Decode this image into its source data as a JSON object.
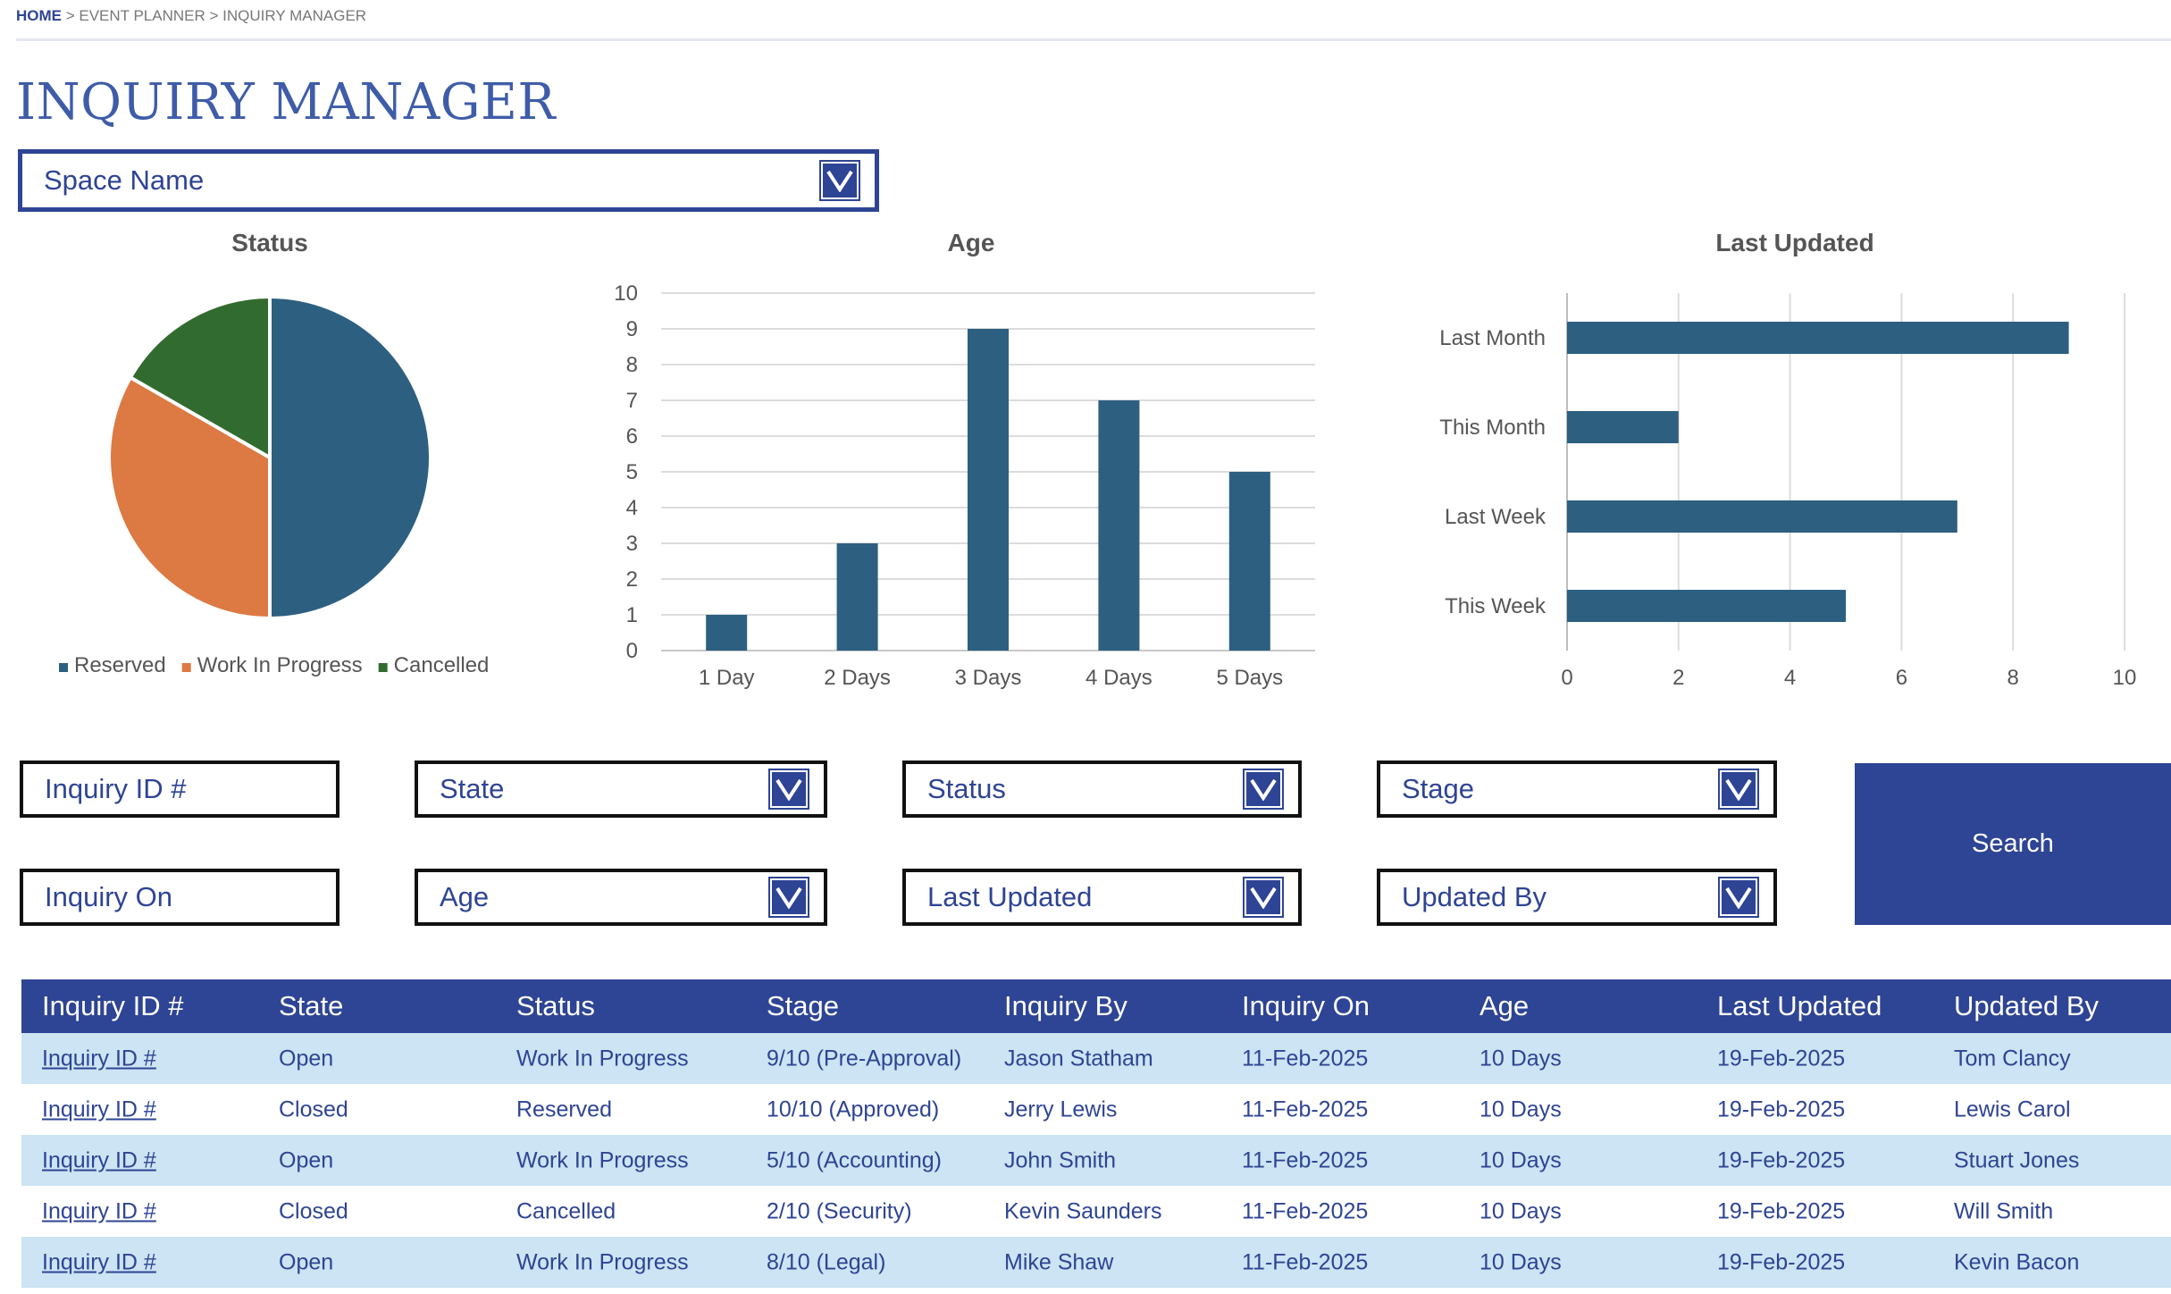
{
  "breadcrumb": {
    "home": "HOME",
    "separator": " > ",
    "event_planner": "EVENT PLANNER",
    "current": "INQUIRY MANAGER"
  },
  "page_title": "INQUIRY MANAGER",
  "space_name": {
    "label": "Space Name",
    "icon": "chevron-down-icon"
  },
  "filters": {
    "inquiry_id": "Inquiry ID #",
    "state": "State",
    "status": "Status",
    "stage": "Stage",
    "inquiry_on": "Inquiry On",
    "age": "Age",
    "last_updated": "Last Updated",
    "updated_by": "Updated By"
  },
  "search_label": "Search",
  "chart_data": [
    {
      "type": "pie",
      "title": "Status",
      "categories": [
        "Reserved",
        "Work In Progress",
        "Cancelled"
      ],
      "values": [
        50,
        33.3,
        16.7
      ],
      "colors": [
        "#2d5f80",
        "#dd7943",
        "#326b2f"
      ],
      "legend": "bottom"
    },
    {
      "type": "bar",
      "title": "Age",
      "categories": [
        "1 Day",
        "2 Days",
        "3 Days",
        "4 Days",
        "5 Days"
      ],
      "values": [
        1,
        3,
        9,
        7,
        5
      ],
      "ylim": [
        0,
        10
      ],
      "yticks": [
        0,
        1,
        2,
        3,
        4,
        5,
        6,
        7,
        8,
        9,
        10
      ],
      "grid": true,
      "color": "#2d5f80"
    },
    {
      "type": "bar",
      "orientation": "horizontal",
      "title": "Last Updated",
      "categories": [
        "Last Month",
        "This Month",
        "Last Week",
        "This Week"
      ],
      "values": [
        9,
        2,
        7,
        5
      ],
      "xlim": [
        0,
        10
      ],
      "xticks": [
        0,
        2,
        4,
        6,
        8,
        10
      ],
      "grid": true,
      "color": "#2d5f80"
    }
  ],
  "table": {
    "headers": [
      "Inquiry ID #",
      "State",
      "Status",
      "Stage",
      "Inquiry By",
      "Inquiry On",
      "Age",
      "Last Updated",
      "Updated By"
    ],
    "rows": [
      [
        "Inquiry ID #",
        "Open",
        "Work In Progress",
        "9/10 (Pre-Approval)",
        "Jason Statham",
        "11-Feb-2025",
        "10 Days",
        "19-Feb-2025",
        "Tom Clancy"
      ],
      [
        "Inquiry ID #",
        "Closed",
        "Reserved",
        "10/10 (Approved)",
        "Jerry Lewis",
        "11-Feb-2025",
        "10 Days",
        "19-Feb-2025",
        "Lewis Carol"
      ],
      [
        "Inquiry ID #",
        "Open",
        "Work In Progress",
        "5/10 (Accounting)",
        "John Smith",
        "11-Feb-2025",
        "10 Days",
        "19-Feb-2025",
        "Stuart Jones"
      ],
      [
        "Inquiry ID #",
        "Closed",
        "Cancelled",
        "2/10 (Security)",
        "Kevin Saunders",
        "11-Feb-2025",
        "10 Days",
        "19-Feb-2025",
        "Will Smith"
      ],
      [
        "Inquiry ID #",
        "Open",
        "Work In Progress",
        "8/10 (Legal)",
        "Mike Shaw",
        "11-Feb-2025",
        "10 Days",
        "19-Feb-2025",
        "Kevin Bacon"
      ]
    ]
  },
  "colors": {
    "accent": "#2e4494",
    "bar": "#2d5f80",
    "row_alt": "#cce4f3"
  }
}
